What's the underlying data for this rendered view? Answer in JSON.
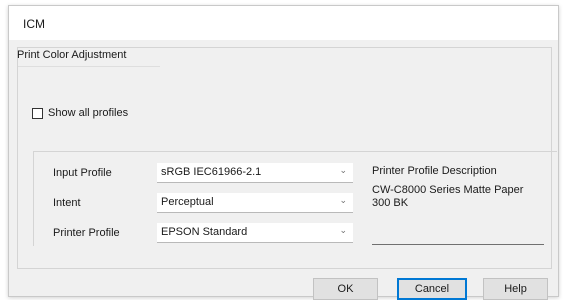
{
  "window": {
    "title": "ICM"
  },
  "group": {
    "label": "Print Color Adjustment"
  },
  "show_all_profiles": {
    "label": "Show all profiles",
    "checked": false
  },
  "fields": {
    "input_profile": {
      "label": "Input Profile",
      "value": "sRGB IEC61966-2.1"
    },
    "intent": {
      "label": "Intent",
      "value": "Perceptual"
    },
    "printer_profile": {
      "label": "Printer Profile",
      "value": "EPSON Standard"
    }
  },
  "description": {
    "title": "Printer Profile Description",
    "text": "CW-C8000 Series Matte Paper 300 BK"
  },
  "buttons": {
    "ok": "OK",
    "cancel": "Cancel",
    "help": "Help"
  },
  "colors": {
    "focus_border": "#0078d4",
    "dialog_bg": "#f0f0f0"
  },
  "icons": {
    "dropdown": "chevron-down-icon"
  }
}
